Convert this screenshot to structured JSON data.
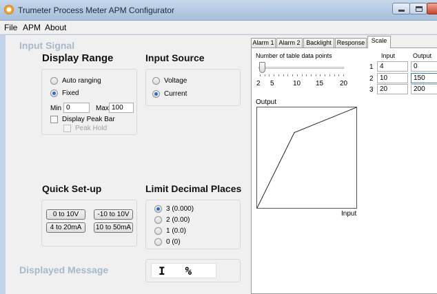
{
  "window": {
    "title": "Trumeter Process Meter APM Configurator"
  },
  "menu": {
    "file": "File",
    "apm": "APM",
    "about": "About"
  },
  "input_signal": {
    "heading": "Input Signal",
    "display_range": {
      "title": "Display Range",
      "auto_ranging": "Auto ranging",
      "fixed": "Fixed",
      "selected": "Fixed",
      "min_label": "Min",
      "min_value": "0",
      "max_label": "Max",
      "max_value": "100",
      "display_peak_bar": "Display Peak Bar",
      "display_peak_bar_checked": false,
      "peak_hold": "Peak Hold",
      "peak_hold_checked": false
    },
    "input_source": {
      "title": "Input Source",
      "voltage": "Voltage",
      "current": "Current",
      "selected": "Current"
    }
  },
  "quick_setup": {
    "title": "Quick Set-up",
    "buttons": [
      "0 to 10V",
      "-10 to 10V",
      "4 to 20mA",
      "10 to 50mA"
    ]
  },
  "decimal_places": {
    "title": "Limit Decimal Places",
    "options": [
      "3 (0.000)",
      "2 (0.00)",
      "1 (0.0)",
      "0 (0)"
    ],
    "selected": "3 (0.000)"
  },
  "displayed_message": {
    "heading": "Displayed Message",
    "value": "I   %"
  },
  "tabs": {
    "labels": [
      "Alarm 1",
      "Alarm 2",
      "Backlight",
      "Response",
      "Scale"
    ],
    "active": "Scale"
  },
  "scale": {
    "points_label": "Number of table data points",
    "slider_value": 2,
    "slider_labels": [
      "2",
      "5",
      "10",
      "15",
      "20"
    ],
    "table_headers": {
      "input": "Input",
      "output": "Output"
    },
    "rows": [
      {
        "index": "1",
        "input": "4",
        "output": "0"
      },
      {
        "index": "2",
        "input": "10",
        "output": "150"
      },
      {
        "index": "3",
        "input": "20",
        "output": "200"
      }
    ],
    "graph_output_label": "Output",
    "graph_input_label": "Input"
  },
  "chart_data": {
    "type": "line",
    "xlabel": "Input",
    "ylabel": "Output",
    "series": [
      {
        "x": [
          4,
          10,
          20
        ],
        "y": [
          0,
          150,
          200
        ]
      }
    ],
    "xlim": [
      4,
      20
    ],
    "ylim": [
      0,
      200
    ],
    "grid": false
  }
}
